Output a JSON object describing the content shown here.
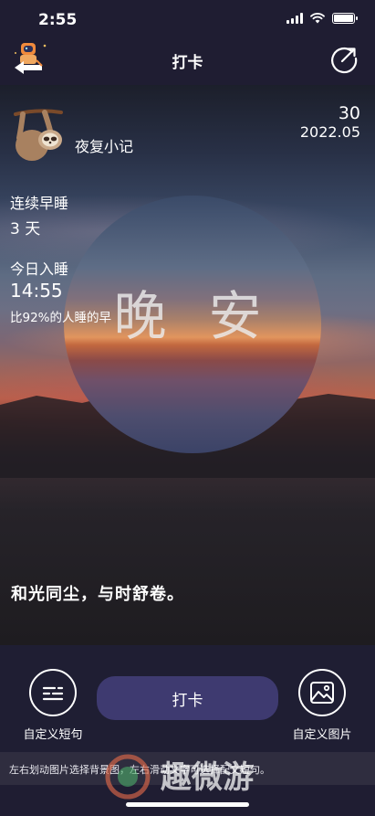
{
  "status_bar": {
    "time": "2:55"
  },
  "nav": {
    "title": "打卡"
  },
  "card": {
    "diary_name": "夜复小记",
    "day": "30",
    "month": "2022.05",
    "streak_label": "连续早睡",
    "streak_value": "3 天",
    "sleep_label": "今日入睡",
    "sleep_time": "14:55",
    "compare_text": "比92%的人睡的早",
    "greeting": "晚安",
    "quote": "和光同尘，与时舒卷。"
  },
  "actions": {
    "custom_phrase_label": "自定义短句",
    "checkin_label": "打卡",
    "custom_image_label": "自定义图片"
  },
  "hint": {
    "text": "左右划动图片选择背景图，左右滑动文字可选择配文短句。"
  },
  "watermark": {
    "text": "趣微游"
  },
  "colors": {
    "background": "#1f1d32",
    "button": "#3e3a70",
    "hint_bar": "#2f2d3f"
  },
  "icons": {
    "back": "astronaut-back-icon",
    "share": "share-circle-icon",
    "avatar": "sloth-avatar",
    "phrase": "text-lines-icon",
    "image": "landscape-image-icon"
  }
}
